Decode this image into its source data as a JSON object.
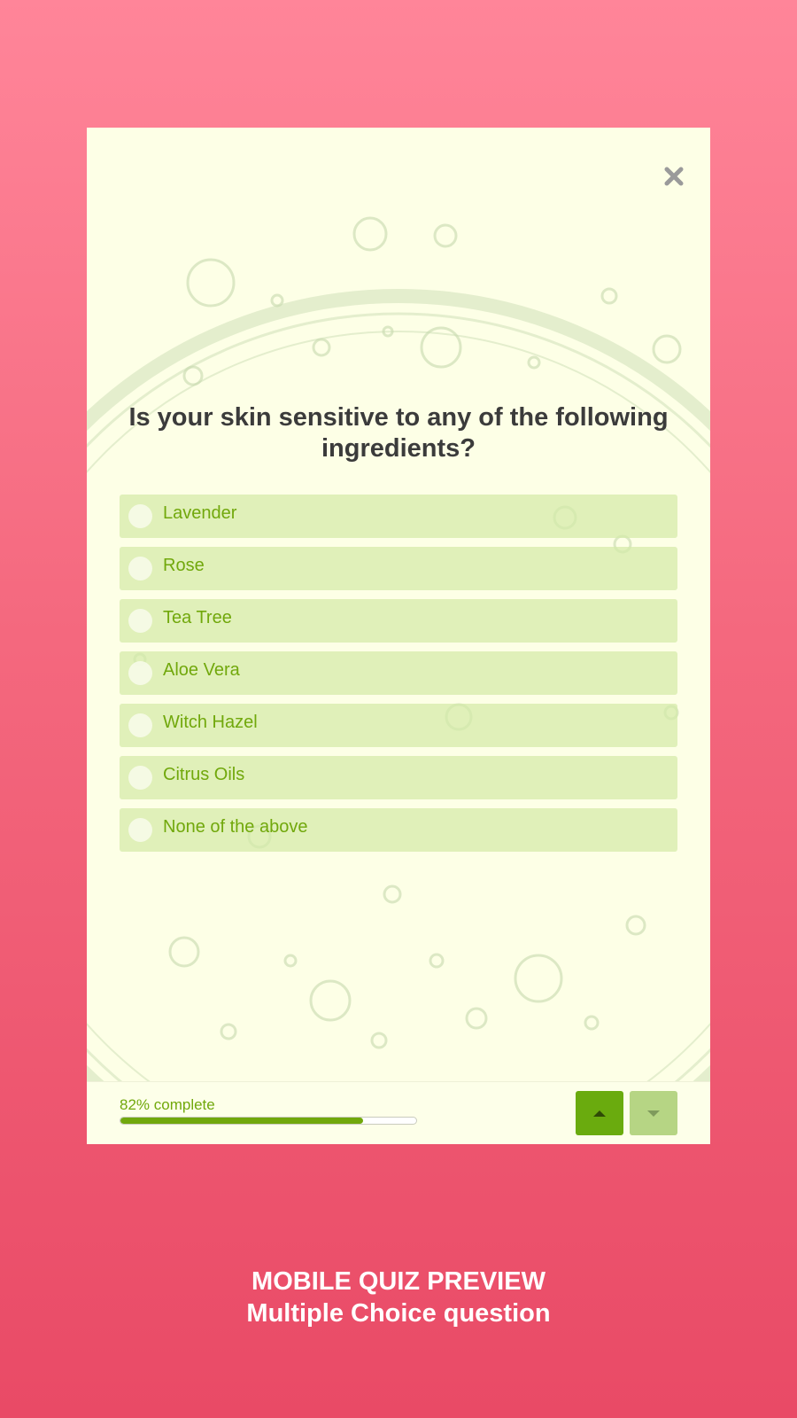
{
  "quiz": {
    "question": "Is your skin sensitive to any of the following ingredients?",
    "options": [
      {
        "label": "Lavender"
      },
      {
        "label": "Rose"
      },
      {
        "label": "Tea Tree"
      },
      {
        "label": "Aloe Vera"
      },
      {
        "label": "Witch Hazel"
      },
      {
        "label": "Citrus Oils"
      },
      {
        "label": "None of the above"
      }
    ],
    "close_icon": "close-icon",
    "progress": {
      "label": "82% complete",
      "percent": 82
    },
    "nav": {
      "up_icon": "caret-up-icon",
      "down_icon": "caret-down-icon"
    }
  },
  "colors": {
    "background_top": "#ff8599",
    "background_bottom": "#e94a66",
    "card": "#fdffe6",
    "accent": "#71a80c",
    "option_bg": "#d4eaa7",
    "question_text": "#3b3b3b",
    "nav_up": "#6aab0e",
    "nav_down": "#b6d584"
  },
  "caption": {
    "line1": "MOBILE QUIZ PREVIEW",
    "line2": "Multiple Choice question"
  }
}
